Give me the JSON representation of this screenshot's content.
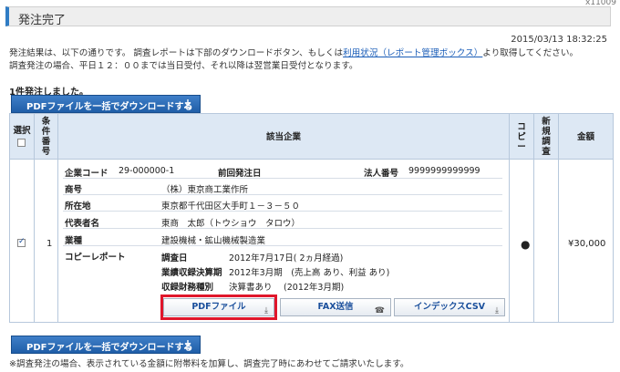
{
  "corner_text": "x11009",
  "title": "発注完了",
  "timestamp": "2015/03/13 18:32:25",
  "description": {
    "line1_pre": "発注結果は、以下の通りです。 調査レポートは下部のダウンロードボタン、もしくは",
    "line1_link": "利用状況（レポート管理ボックス）",
    "line1_post": "より取得してください。",
    "line2": "調査発注の場合、平日１２：００までは当日受付、それ以降は翌営業日受付となります。"
  },
  "order_count": "1件発注しました。",
  "download_all_label": "PDFファイルを一括でダウンロードする",
  "table": {
    "headers": {
      "select": "選択",
      "item_no": [
        "条",
        "件",
        "番",
        "号"
      ],
      "company": "該当企業",
      "copy": [
        "コ",
        "ピ",
        "ー"
      ],
      "new_survey": [
        "新",
        "規",
        "調",
        "査"
      ],
      "amount": "金額"
    },
    "row": {
      "number": "1",
      "copy_mark": "●",
      "amount": "¥30,000",
      "company_code_label": "企業コード",
      "company_code": "29-000000-1",
      "prev_order_label": "前回発注日",
      "corp_no_label": "法人番号",
      "corp_no": "9999999999999",
      "name_label": "商号",
      "name": "（株）東京商工業作所",
      "address_label": "所在地",
      "address": "東京都千代田区大手町１－３－５０",
      "rep_label": "代表者名",
      "rep": "東商　太郎（トウショウ　タロウ）",
      "industry_label": "業種",
      "industry": "建設機械・鉱山機械製造業",
      "copy_report_label": "コピーレポート",
      "survey_date_label": "調査日",
      "survey_date": "2012年7月17日( 2ヵ月経過)",
      "results_label": "業績収録決算期",
      "results": "2012年3月期　(売上高 あり、利益 あり)",
      "finance_label": "収録財務種別",
      "finance": "決算書あり　 (2012年3月期)"
    },
    "actions": {
      "pdf": "PDFファイル",
      "fax": "FAX送信",
      "index_csv": "インデックスCSV"
    }
  },
  "footnote": "※調査発注の場合、表示されている金額に附帯料を加算し、調査完了時にあわせてご請求いたします。",
  "colors": {
    "accent": "#2f7cc4",
    "button_blue": "#1f5ea8",
    "highlight": "#e0162b",
    "header_bg": "#dde8f4"
  }
}
